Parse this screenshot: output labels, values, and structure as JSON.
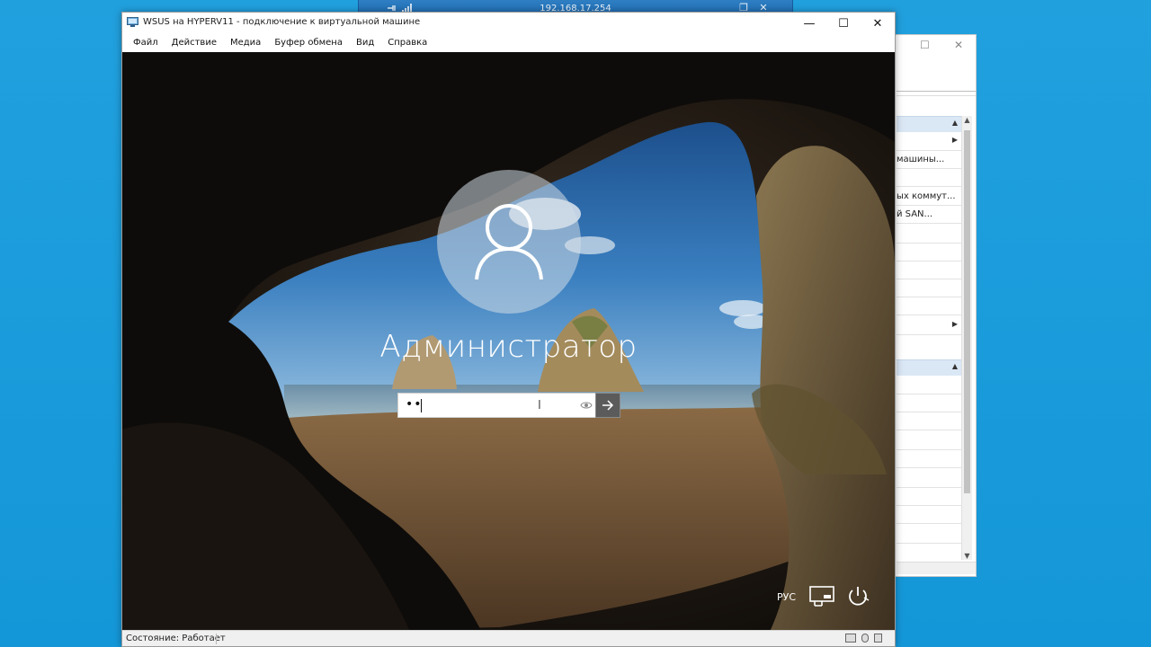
{
  "rdp_bar": {
    "ip": "192.168.17.254"
  },
  "vm_window": {
    "title": "WSUS на HYPERV11 - подключение к виртуальной машине",
    "menu": [
      "Файл",
      "Действие",
      "Медиа",
      "Буфер обмена",
      "Вид",
      "Справка"
    ],
    "status": "Состояние: Работает"
  },
  "lock_screen": {
    "username": "Администратор",
    "password_value": "••",
    "language": "РУС"
  },
  "background_window": {
    "rows": [
      "машины...",
      "ых коммут...",
      "й SAN..."
    ]
  },
  "colors": {
    "desktop": "#1497d8",
    "rdp_bar": "#1d6ab2",
    "action_header": "#dae7f5"
  }
}
